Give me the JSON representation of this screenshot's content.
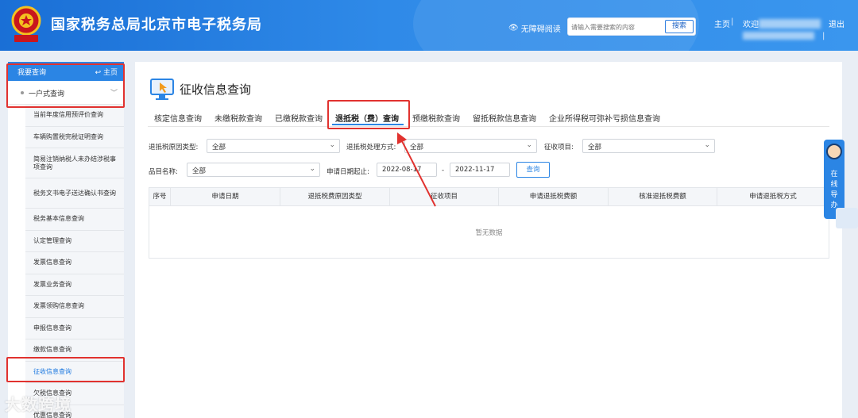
{
  "header": {
    "title": "国家税务总局北京市电子税务局",
    "accessibility_label": "无障碍阅读",
    "search": {
      "placeholder": "请输入需要搜索的内容",
      "button": "搜索"
    },
    "home_link": "主页",
    "welcome": "欢迎",
    "logout": "退出"
  },
  "sidebar": {
    "head_title": "我要查询",
    "head_home": "主页",
    "group_label": "一户式查询",
    "items": [
      {
        "label": "当前年度信用预评价查询"
      },
      {
        "label": "车辆购置税完税证明查询"
      },
      {
        "label": "简易注销纳税人未办结涉税事项查询"
      },
      {
        "label": "税务文书电子送达确认书查询"
      },
      {
        "label": "税务基本信息查询"
      },
      {
        "label": "认定管理查询"
      },
      {
        "label": "发票信息查询"
      },
      {
        "label": "发票业务查询"
      },
      {
        "label": "发票领购信息查询"
      },
      {
        "label": "申报信息查询"
      },
      {
        "label": "缴款信息查询"
      },
      {
        "label": "征收信息查询"
      },
      {
        "label": "欠税信息查询"
      },
      {
        "label": "优惠信息查询"
      }
    ]
  },
  "main": {
    "title": "征收信息查询",
    "tabs": [
      {
        "label": "核定信息查询"
      },
      {
        "label": "未缴税款查询"
      },
      {
        "label": "已缴税款查询"
      },
      {
        "label": "退抵税（费）查询"
      },
      {
        "label": "预缴税款查询"
      },
      {
        "label": "留抵税款信息查询"
      },
      {
        "label": "企业所得税可弥补亏损信息查询"
      }
    ],
    "filters": {
      "reason_label": "退抵税原因类型:",
      "reason_value": "全部",
      "method_label": "退抵税处理方式:",
      "method_value": "全部",
      "levy_label": "征收项目:",
      "levy_value": "全部",
      "item_label": "品目名称:",
      "item_value": "全部",
      "date_label": "申请日期起止:",
      "date_from": "2022-08-17",
      "date_sep": "-",
      "date_to": "2022-11-17",
      "query_button": "查询"
    },
    "table": {
      "columns": [
        "序号",
        "申请日期",
        "退抵税费原因类型",
        "征收项目",
        "申请退抵税费额",
        "核准退抵税费额",
        "申请退抵税方式"
      ],
      "empty_text": "暂无数据"
    }
  },
  "help_float": {
    "text": [
      "在",
      "线",
      "导",
      "办"
    ]
  },
  "watermark": "大数跨境"
}
